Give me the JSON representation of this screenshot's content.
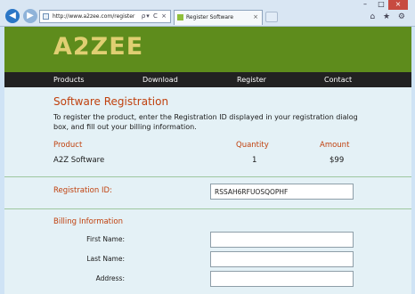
{
  "browser": {
    "url": "http://www.a2zee.com/register",
    "tab_title": "Register Software",
    "addr_actions": "ρ▾ C ×",
    "tab_close": "×",
    "win_min": "–",
    "win_max": "□",
    "win_close": "×",
    "tool_icons": "⌂ ★ ⚙"
  },
  "site": {
    "logo": "A2ZEE",
    "nav": [
      "Products",
      "Download",
      "Register",
      "Contact"
    ]
  },
  "main": {
    "title": "Software Registration",
    "description": "To register the product, enter the Registration ID displayed in your registration dialog box, and fill out your billing information.",
    "table": {
      "headers": [
        "Product",
        "Quantity",
        "Amount"
      ],
      "row": [
        "A2Z Software",
        "1",
        "$99"
      ]
    },
    "registration": {
      "label": "Registration ID:",
      "value": "RSSAH6RFUOSQOPHF"
    },
    "billing": {
      "title": "Billing Information",
      "fields": [
        {
          "label": "First Name:",
          "value": ""
        },
        {
          "label": "Last Name:",
          "value": ""
        },
        {
          "label": "Address:",
          "value": ""
        }
      ]
    }
  }
}
